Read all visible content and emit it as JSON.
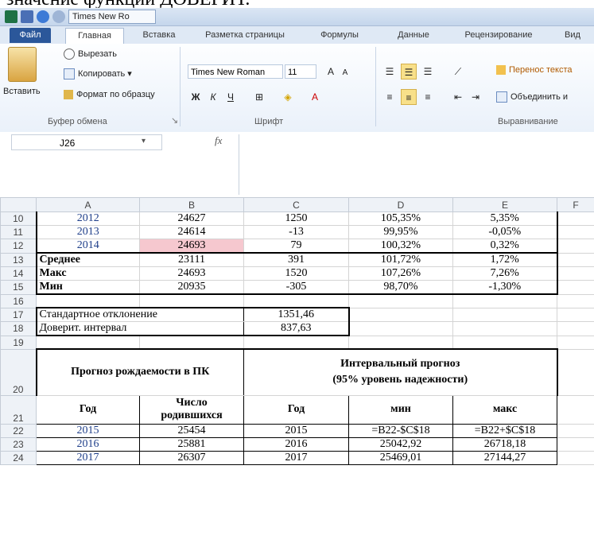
{
  "caption": "значение функции ДОВЕРИТ.",
  "window": {
    "qat_font": "Times New Ro"
  },
  "tabs": [
    {
      "label": "Файл"
    },
    {
      "label": "Главная"
    },
    {
      "label": "Вставка"
    },
    {
      "label": "Разметка страницы"
    },
    {
      "label": "Формулы"
    },
    {
      "label": "Данные"
    },
    {
      "label": "Рецензирование"
    },
    {
      "label": "Вид"
    }
  ],
  "ribbon": {
    "paste": "Вставить",
    "cut": "Вырезать",
    "copy": "Копировать",
    "format_painter": "Формат по образцу",
    "clipboard_group": "Буфер обмена",
    "font_name": "Times New Roman",
    "font_size": "11",
    "bold": "Ж",
    "italic": "К",
    "underline": "Ч",
    "font_group": "Шрифт",
    "wrap_text": "Перенос текста",
    "merge": "Объединить и",
    "align_group": "Выравнивание"
  },
  "formula_bar": {
    "name_box": "J26",
    "fx": "fx",
    "formula": ""
  },
  "columns": [
    "A",
    "B",
    "C",
    "D",
    "E",
    "F"
  ],
  "rows": [
    {
      "n": "10",
      "a": "2012",
      "b": "24627",
      "c": "1250",
      "d": "105,35%",
      "e": "5,35%"
    },
    {
      "n": "11",
      "a": "2013",
      "b": "24614",
      "c": "-13",
      "d": "99,95%",
      "e": "-0,05%"
    },
    {
      "n": "12",
      "a": "2014",
      "b": "24693",
      "c": "79",
      "d": "100,32%",
      "e": "0,32%"
    },
    {
      "n": "13",
      "a": "Среднее",
      "b": "23111",
      "c": "391",
      "d": "101,72%",
      "e": "1,72%"
    },
    {
      "n": "14",
      "a": "Макс",
      "b": "24693",
      "c": "1520",
      "d": "107,26%",
      "e": "7,26%"
    },
    {
      "n": "15",
      "a": "Мин",
      "b": "20935",
      "c": "-305",
      "d": "98,70%",
      "e": "-1,30%"
    }
  ],
  "r16": "16",
  "r17": {
    "n": "17",
    "label": "Стандартное отклонение",
    "value": "1351,46"
  },
  "r18": {
    "n": "18",
    "label": "Доверит. интервал",
    "value": "837,63"
  },
  "r19": "19",
  "r20": {
    "n": "20",
    "left": "Прогноз рождаемости в ПК",
    "right1": "Интервальный прогноз",
    "right2": "(95% уровень надежности)"
  },
  "r21": {
    "n": "21",
    "a": "Год",
    "b1": "Число",
    "b2": "родившихся",
    "c": "Год",
    "d": "мин",
    "e": "макс"
  },
  "forecast": [
    {
      "n": "22",
      "a": "2015",
      "b": "25454",
      "c": "2015",
      "d": "=B22-$C$18",
      "e": "=B22+$C$18"
    },
    {
      "n": "23",
      "a": "2016",
      "b": "25881",
      "c": "2016",
      "d": "25042,92",
      "e": "26718,18"
    },
    {
      "n": "24",
      "a": "2017",
      "b": "26307",
      "c": "2017",
      "d": "25469,01",
      "e": "27144,27"
    }
  ]
}
